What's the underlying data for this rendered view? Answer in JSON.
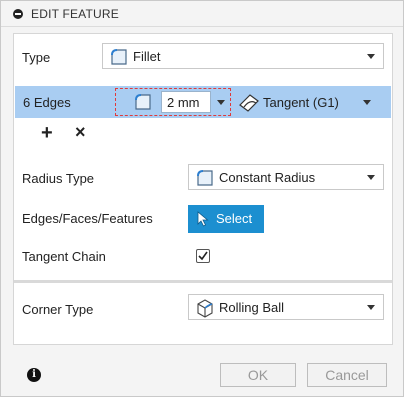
{
  "header": {
    "title": "EDIT FEATURE"
  },
  "type_row": {
    "label": "Type",
    "value": "Fillet"
  },
  "edges_row": {
    "label": "6 Edges",
    "radius_value": "2 mm",
    "continuity": "Tangent (G1)",
    "add_symbol": "+",
    "remove_symbol": "×"
  },
  "radius_type": {
    "label": "Radius Type",
    "value": "Constant Radius"
  },
  "edges_faces_features": {
    "label": "Edges/Faces/Features",
    "button_label": "Select"
  },
  "tangent_chain": {
    "label": "Tangent Chain",
    "checked": true
  },
  "corner_type": {
    "label": "Corner Type",
    "value": "Rolling Ball"
  },
  "footer": {
    "info": "i",
    "ok_label": "OK",
    "cancel_label": "Cancel"
  },
  "colors": {
    "selected_row": "#a9cdf2",
    "select_button": "#1c8fd0",
    "highlight_dash": "#e03a3a"
  }
}
